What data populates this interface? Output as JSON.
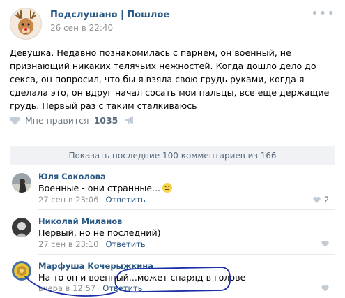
{
  "post": {
    "group_name": "Подслушано | Пошлое",
    "date": "26 сен в 22:40",
    "text": "Девушка. Недавно познакомилась с парнем, он военный, не признающий никаких телячьих нежностей. Когда дошло дело до секса, он попросил, что бы я взяла свою грудь руками, когда я сделала это, он вдруг начал сосать мои пальцы, все еще держащие грудь. Первый раз с таким сталкиваюсь",
    "like_label": "Мне нравится",
    "like_count": "1035"
  },
  "comments_header": {
    "show_more": "Показать последние 100 комментариев из 166"
  },
  "comments": [
    {
      "author": "Юля Соколова",
      "text": "Военные - они странные...",
      "date": "27 сен в 23:06",
      "reply": "Ответить",
      "likes": "2"
    },
    {
      "author": "Николай Миланов",
      "text": "Первый, но не последний)",
      "date": "27 сен в 23:10",
      "reply": "Ответить",
      "likes": ""
    },
    {
      "author": "Марфуша Кочерыжкина",
      "text": "На то он и военный...может снаряд в голове",
      "date": "вчера в 12:57",
      "reply": "Ответить",
      "likes": ""
    }
  ],
  "icons": {
    "more": "more-dots-icon",
    "like": "heart-icon",
    "share": "megaphone-icon",
    "emoji": "emoji-icon"
  },
  "colors": {
    "link": "#2a5885",
    "meta": "#939393",
    "annotation": "#1c2fa8"
  }
}
